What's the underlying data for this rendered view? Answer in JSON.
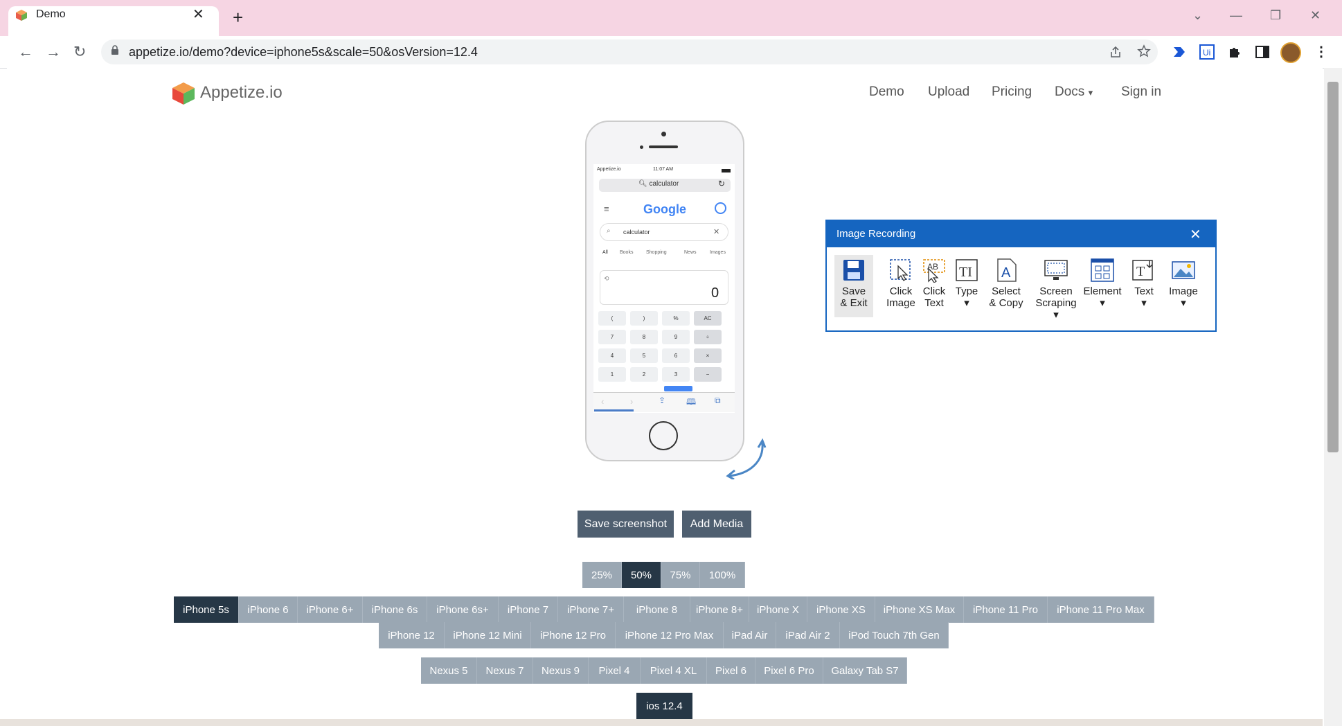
{
  "browser": {
    "tab_title": "Demo",
    "tab_close": "✕",
    "new_tab": "+",
    "window_controls": [
      "⌄",
      "—",
      "❐",
      "✕"
    ],
    "back": "←",
    "forward": "→",
    "reload": "↻",
    "lock": "🔒",
    "url": "appetize.io/demo?device=iphone5s&scale=50&osVersion=12.4",
    "toolbar_icons": [
      "share-icon",
      "star-icon",
      "extension-arrow-icon",
      "ui-icon",
      "puzzle-icon",
      "sidebar-icon",
      "profile-avatar",
      "menu-icon"
    ]
  },
  "site": {
    "brand": "Appetize.io",
    "nav": [
      "Demo",
      "Upload",
      "Pricing",
      "Docs",
      "Sign in"
    ],
    "docs_caret": "▾"
  },
  "phone_screen": {
    "carrier": "Appetize.io",
    "time": "11:07 AM",
    "address": "calculator",
    "google_logo": "Google",
    "search_query": "calculator",
    "tabs": [
      "All",
      "Books",
      "Shopping",
      "News",
      "Images"
    ],
    "display": "0",
    "keys": [
      [
        "(",
        ")",
        "%",
        "AC"
      ],
      [
        "7",
        "8",
        "9",
        "÷"
      ],
      [
        "4",
        "5",
        "6",
        "×"
      ],
      [
        "1",
        "2",
        "3",
        "−"
      ]
    ]
  },
  "buttons": {
    "save_screenshot": "Save screenshot",
    "add_media": "Add Media"
  },
  "scales": [
    {
      "label": "25%",
      "selected": false
    },
    {
      "label": "50%",
      "selected": true
    },
    {
      "label": "75%",
      "selected": false
    },
    {
      "label": "100%",
      "selected": false
    }
  ],
  "ios_devices_row1": [
    {
      "label": "iPhone 5s",
      "selected": true
    },
    {
      "label": "iPhone 6"
    },
    {
      "label": "iPhone 6+"
    },
    {
      "label": "iPhone 6s"
    },
    {
      "label": "iPhone 6s+"
    },
    {
      "label": "iPhone 7"
    },
    {
      "label": "iPhone 7+"
    },
    {
      "label": "iPhone 8"
    },
    {
      "label": "iPhone 8+"
    },
    {
      "label": "iPhone X"
    },
    {
      "label": "iPhone XS"
    },
    {
      "label": "iPhone XS Max"
    },
    {
      "label": "iPhone 11 Pro"
    },
    {
      "label": "iPhone 11 Pro Max"
    }
  ],
  "ios_devices_row2": [
    {
      "label": "iPhone 12"
    },
    {
      "label": "iPhone 12 Mini"
    },
    {
      "label": "iPhone 12 Pro"
    },
    {
      "label": "iPhone 12 Pro Max"
    },
    {
      "label": "iPad Air"
    },
    {
      "label": "iPad Air 2"
    },
    {
      "label": "iPod Touch 7th Gen"
    }
  ],
  "android_devices": [
    {
      "label": "Nexus 5"
    },
    {
      "label": "Nexus 7"
    },
    {
      "label": "Nexus 9"
    },
    {
      "label": "Pixel 4"
    },
    {
      "label": "Pixel 4 XL"
    },
    {
      "label": "Pixel 6"
    },
    {
      "label": "Pixel 6 Pro"
    },
    {
      "label": "Galaxy Tab S7"
    }
  ],
  "os_version": "ios 12.4",
  "recording_panel": {
    "title": "Image Recording",
    "close": "✕",
    "tools": [
      {
        "line1": "Save",
        "line2": "& Exit",
        "icon": "floppy-disk-icon"
      },
      {
        "line1": "Click",
        "line2": "Image",
        "icon": "click-image-icon"
      },
      {
        "line1": "Click",
        "line2": "Text",
        "icon": "click-text-icon"
      },
      {
        "line1": "Type",
        "line2": "▾",
        "icon": "type-icon"
      },
      {
        "line1": "Select",
        "line2": "& Copy",
        "icon": "select-copy-icon"
      },
      {
        "line1": "Screen",
        "line2": "Scraping ▾",
        "icon": "screen-scraping-icon"
      },
      {
        "line1": "Element",
        "line2": "▾",
        "icon": "element-icon"
      },
      {
        "line1": "Text",
        "line2": "▾",
        "icon": "text-icon"
      },
      {
        "line1": "Image",
        "line2": "▾",
        "icon": "image-icon"
      }
    ]
  },
  "colors": {
    "tabstrip": "#f6d5e3",
    "accent_blue": "#1565c0",
    "pill": "#9aa7b3",
    "pill_selected": "#263746",
    "dark_button": "#4f5f70"
  }
}
